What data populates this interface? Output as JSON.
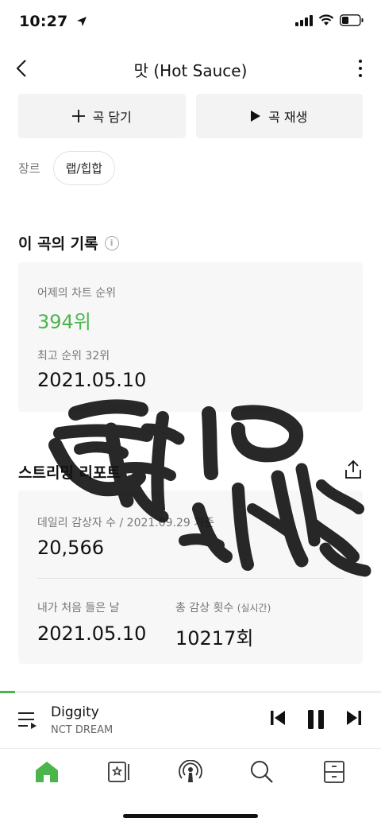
{
  "status": {
    "time": "10:27"
  },
  "nav": {
    "title": "맛 (Hot Sauce)"
  },
  "actions": {
    "add_label": "곡 담기",
    "play_label": "곡 재생"
  },
  "genre": {
    "label": "장르",
    "value": "랩/힙합"
  },
  "history": {
    "title": "이 곡의 기록",
    "chart_label": "어제의 차트 순위",
    "chart_rank": "394위",
    "best_rank": "최고 순위 32위",
    "best_date": "2021.05.10"
  },
  "streaming": {
    "title": "스트리밍 리포트",
    "daily_label": "데일리 감상자 수 / 2021.09.29 기준",
    "daily_value": "20,566",
    "first_label": "내가 처음 들은 날",
    "first_value": "2021.05.10",
    "total_label": "총 감상 횟수",
    "total_sub": "(실시간)",
    "total_value": "10217회"
  },
  "player": {
    "title": "Diggity",
    "artist": "NCT DREAM",
    "progress": 0.04
  },
  "tabs": [
    "home-icon",
    "my-library-icon",
    "podcast-icon",
    "search-icon",
    "storage-icon"
  ],
  "colors": {
    "accent": "#4bb54b"
  }
}
